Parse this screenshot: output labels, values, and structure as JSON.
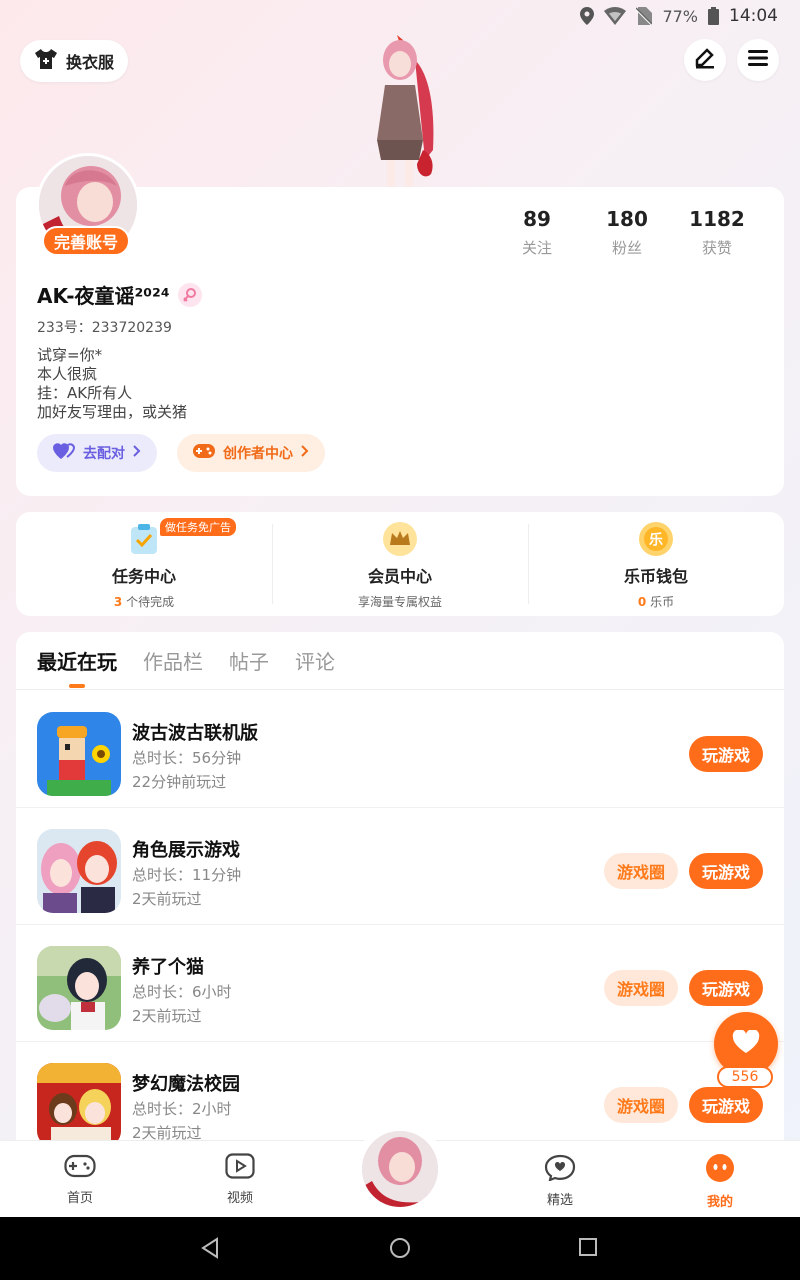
{
  "status_bar": {
    "battery": "77%",
    "time": "14:04"
  },
  "header": {
    "outfit_button": "换衣服"
  },
  "profile": {
    "complete_badge": "完善账号",
    "stats": [
      {
        "value": "89",
        "label": "关注"
      },
      {
        "value": "180",
        "label": "粉丝"
      },
      {
        "value": "1182",
        "label": "获赞"
      }
    ],
    "username": "AK-夜童谣²⁰²⁴",
    "uid": "233号：233720239",
    "bio": [
      "试穿=你*",
      "本人很疯",
      "挂：AK所有人",
      "加好友写理由，或关猪"
    ],
    "chip_pair": "去配对",
    "chip_creator": "创作者中心"
  },
  "menu": {
    "tasks": {
      "title": "任务中心",
      "count": "3",
      "sub": "个待完成",
      "ad_tag": "做任务免广告"
    },
    "vip": {
      "title": "会员中心",
      "sub": "享海量专属权益"
    },
    "wallet": {
      "title": "乐币钱包",
      "count": "0",
      "sub": "乐币",
      "icon_char": "乐"
    }
  },
  "tabs": [
    "最近在玩",
    "作品栏",
    "帖子",
    "评论"
  ],
  "games": [
    {
      "name": "波古波古联机版",
      "duration": "总时长：56分钟",
      "last_played": "22分钟前玩过",
      "play": "玩游戏",
      "circle": ""
    },
    {
      "name": "角色展示游戏",
      "duration": "总时长：11分钟",
      "last_played": "2天前玩过",
      "play": "玩游戏",
      "circle": "游戏圈"
    },
    {
      "name": "养了个猫",
      "duration": "总时长：6小时",
      "last_played": "2天前玩过",
      "play": "玩游戏",
      "circle": "游戏圈"
    },
    {
      "name": "梦幻魔法校园",
      "duration": "总时长：2小时",
      "last_played": "2天前玩过",
      "play": "玩游戏",
      "circle": "游戏圈"
    }
  ],
  "fab": {
    "count": "556"
  },
  "bottom_nav": [
    "首页",
    "视频",
    "精选",
    "我的"
  ],
  "colors": {
    "accent": "#ff6d1a",
    "accent_light": "#ffe8da",
    "pair_purple": "#6a5fe0"
  }
}
